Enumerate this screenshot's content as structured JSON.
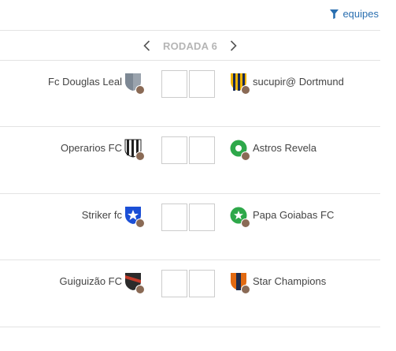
{
  "filter": {
    "label": "equipes",
    "icon": "filter-icon",
    "color": "#2a6fb0"
  },
  "round": {
    "label": "RODADA 6",
    "prev_icon": "chevron-left-icon",
    "next_icon": "chevron-right-icon"
  },
  "matches": [
    {
      "home": "Fc Douglas Leal",
      "away": "sucupir@ Dortmund",
      "home_score": "",
      "away_score": ""
    },
    {
      "home": "Operarios FC",
      "away": "Astros Revela",
      "home_score": "",
      "away_score": ""
    },
    {
      "home": "Striker fc",
      "away": "Papa Goiabas FC",
      "home_score": "",
      "away_score": ""
    },
    {
      "home": "Guiguizão FC",
      "away": "Star Champions",
      "home_score": "",
      "away_score": ""
    }
  ]
}
